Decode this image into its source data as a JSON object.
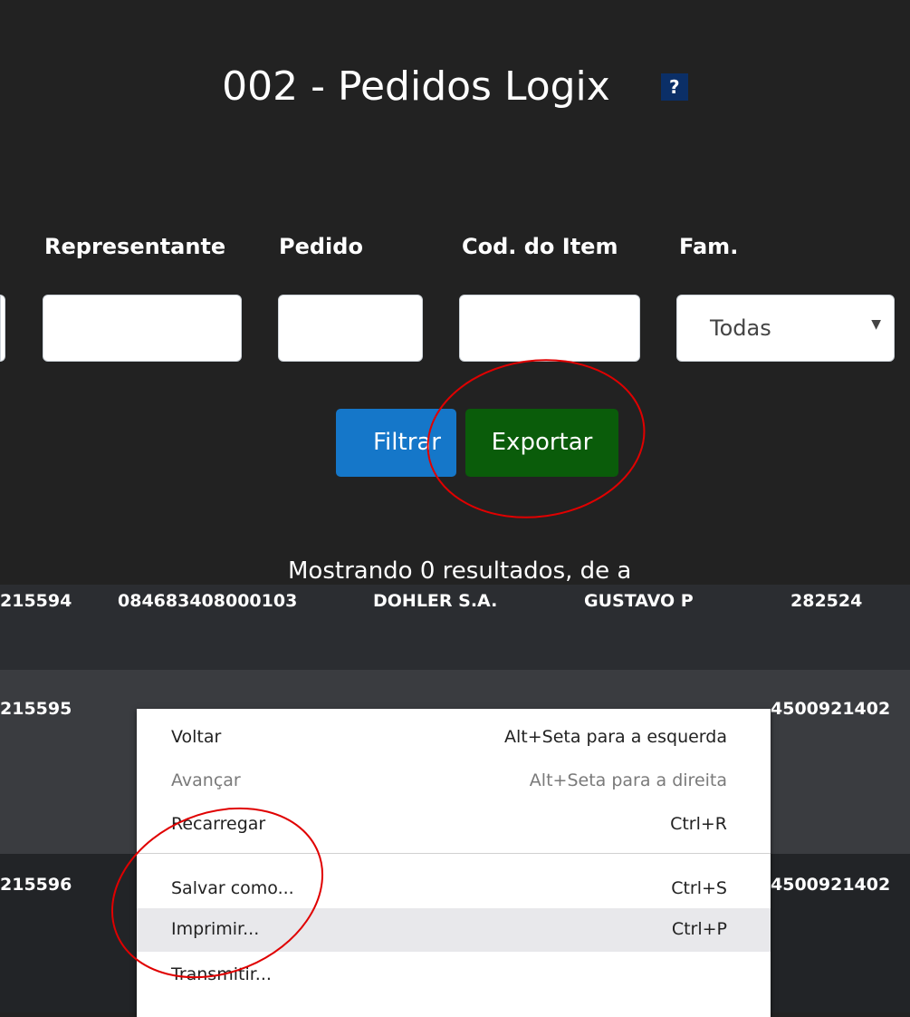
{
  "page": {
    "title": "002 - Pedidos Logix",
    "help_label": "?"
  },
  "filters": {
    "labels": {
      "representante": "Representante",
      "pedido": "Pedido",
      "cod_item": "Cod. do Item",
      "fam": "Fam."
    },
    "values": {
      "representante": "",
      "pedido": "",
      "cod_item": "",
      "fam": "Todas"
    }
  },
  "buttons": {
    "filtrar": "Filtrar",
    "exportar": "Exportar"
  },
  "colors": {
    "background": "#222222",
    "filtrar": "#1577c9",
    "exportar": "#0a5c0a",
    "annotation": "#e00000"
  },
  "status": "Mostrando 0 resultados, de a",
  "table": {
    "rows": [
      [
        "215594",
        "084683408000103",
        "DOHLER S.A.",
        "GUSTAVO P",
        "282524"
      ],
      [
        "215595",
        "",
        "",
        "",
        "4500921402"
      ],
      [
        "215596",
        "",
        "",
        "",
        "4500921402"
      ]
    ]
  },
  "context_menu": {
    "items": [
      {
        "label": "Voltar",
        "shortcut": "Alt+Seta para a esquerda",
        "disabled": false
      },
      {
        "label": "Avançar",
        "shortcut": "Alt+Seta para a direita",
        "disabled": true
      },
      {
        "label": "Recarregar",
        "shortcut": "Ctrl+R",
        "disabled": false
      },
      {
        "label": "Salvar como...",
        "shortcut": "Ctrl+S",
        "disabled": false
      },
      {
        "label": "Imprimir...",
        "shortcut": "Ctrl+P",
        "disabled": false
      },
      {
        "label": "Transmitir...",
        "shortcut": "",
        "disabled": false
      }
    ]
  }
}
